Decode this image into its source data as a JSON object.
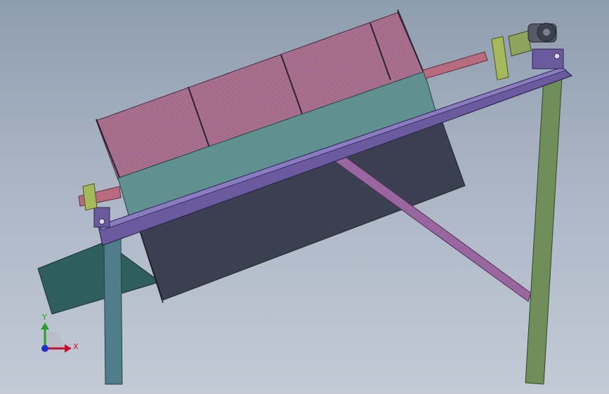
{
  "triad": {
    "x_label": "X",
    "y_label": "Y",
    "x_color": "#c8102e",
    "y_color": "#2aa02a",
    "z_color": "#1a2fd0"
  },
  "colors": {
    "background_top": "#8e9db0",
    "background_bottom": "#c3cad6",
    "drum_mesh": "#b07a97",
    "drum_shell": "#5f9190",
    "frame_beam": "#6b5a9e",
    "hopper": "#3a4050",
    "chute": "#2f5e5e",
    "front_leg": "#4f7e8a",
    "rear_leg": "#6e8f5a",
    "brace": "#9a66a0",
    "shaft": "#b86a7e",
    "bearing": "#a7b85a",
    "motor": "#555b66"
  }
}
